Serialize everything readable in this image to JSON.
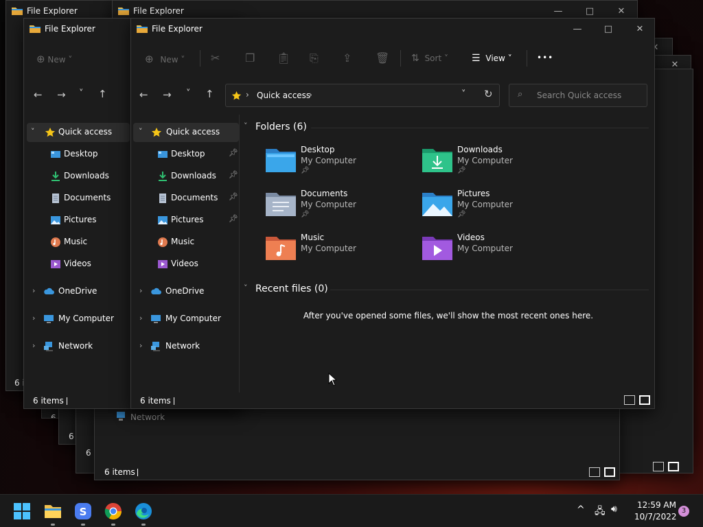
{
  "window": {
    "title": "File Explorer",
    "min_glyph": "—",
    "max_glyph": "□",
    "close_glyph": "✕"
  },
  "toolbar": {
    "new_label": "New",
    "sort_label": "Sort",
    "view_label": "View",
    "more_label": "•••"
  },
  "address": {
    "location": "Quick access",
    "sep": "›",
    "search_placeholder": "Search Quick access"
  },
  "sidebar": {
    "quick_access": "Quick access",
    "items": [
      {
        "label": "Desktop",
        "icon": "desktop-icon"
      },
      {
        "label": "Downloads",
        "icon": "download-icon"
      },
      {
        "label": "Documents",
        "icon": "document-icon"
      },
      {
        "label": "Pictures",
        "icon": "pictures-icon"
      },
      {
        "label": "Music",
        "icon": "music-icon"
      },
      {
        "label": "Videos",
        "icon": "videos-icon"
      }
    ],
    "onedrive": "OneDrive",
    "my_computer": "My Computer",
    "network": "Network"
  },
  "main": {
    "folders_header": "Folders (6)",
    "folders": [
      {
        "name": "Desktop",
        "location": "My Computer"
      },
      {
        "name": "Downloads",
        "location": "My Computer"
      },
      {
        "name": "Documents",
        "location": "My Computer"
      },
      {
        "name": "Pictures",
        "location": "My Computer"
      },
      {
        "name": "Music",
        "location": "My Computer"
      },
      {
        "name": "Videos",
        "location": "My Computer"
      }
    ],
    "recent_header": "Recent files (0)",
    "recent_empty": "After you've opened some files, we'll show the most recent ones here."
  },
  "status": {
    "items_count": "6 items",
    "items_partial": "6 i"
  },
  "taskbar": {
    "time": "12:59 AM",
    "date": "10/7/2022",
    "notifications": "3"
  },
  "colors": {
    "accent_blue": "#3a96dd",
    "folder_yellow": "#f2c14e",
    "star_yellow": "#f5c518",
    "notification_badge": "#d48fd8"
  }
}
